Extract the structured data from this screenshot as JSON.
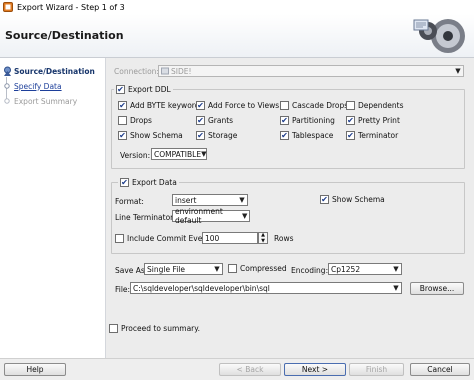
{
  "window": {
    "title": "Export Wizard - Step 1 of 3"
  },
  "header": {
    "title": "Source/Destination"
  },
  "nav": {
    "items": [
      {
        "label": "Source/Destination",
        "state": "current"
      },
      {
        "label": "Specify Data",
        "state": "link"
      },
      {
        "label": "Export Summary",
        "state": "disabled"
      }
    ]
  },
  "connection": {
    "label": "Connection:",
    "value": "SIDE!"
  },
  "export_ddl": {
    "label": "Export DDL",
    "checked": true,
    "options": [
      {
        "label": "Add BYTE keyword",
        "checked": true
      },
      {
        "label": "Add Force to Views",
        "checked": true
      },
      {
        "label": "Cascade Drops",
        "checked": false
      },
      {
        "label": "Dependents",
        "checked": false
      },
      {
        "label": "Drops",
        "checked": false
      },
      {
        "label": "Grants",
        "checked": true
      },
      {
        "label": "Partitioning",
        "checked": true
      },
      {
        "label": "Pretty Print",
        "checked": true
      },
      {
        "label": "Show Schema",
        "checked": true
      },
      {
        "label": "Storage",
        "checked": true
      },
      {
        "label": "Tablespace",
        "checked": true
      },
      {
        "label": "Terminator",
        "checked": true
      }
    ],
    "version_label": "Version:",
    "version_value": "COMPATIBLE"
  },
  "export_data": {
    "label": "Export Data",
    "checked": true,
    "format_label": "Format:",
    "format_value": "insert",
    "show_schema_label": "Show Schema",
    "show_schema_checked": true,
    "line_terminator_label": "Line Terminator:",
    "line_terminator_value": "environment default",
    "include_commit_label": "Include Commit Every",
    "include_commit_checked": false,
    "commit_value": "100",
    "rows_label": "Rows"
  },
  "save_as": {
    "label": "Save As",
    "value": "Single File",
    "compressed_label": "Compressed",
    "compressed_checked": false,
    "encoding_label": "Encoding:",
    "encoding_value": "Cp1252"
  },
  "file": {
    "label": "File:",
    "value": "C:\\sqldeveloper\\sqldeveloper\\bin\\sql",
    "browse_label": "Browse..."
  },
  "proceed": {
    "label": "Proceed to summary.",
    "checked": false
  },
  "footer": {
    "help": "Help",
    "back": "< Back",
    "next": "Next >",
    "finish": "Finish",
    "cancel": "Cancel"
  },
  "icons": {
    "check": "✔",
    "dropdown": "▼",
    "spin_up": "▲",
    "spin_down": "▼",
    "nav_current": "navigation-current-icon",
    "nav_pending": "navigation-pending-icon"
  }
}
